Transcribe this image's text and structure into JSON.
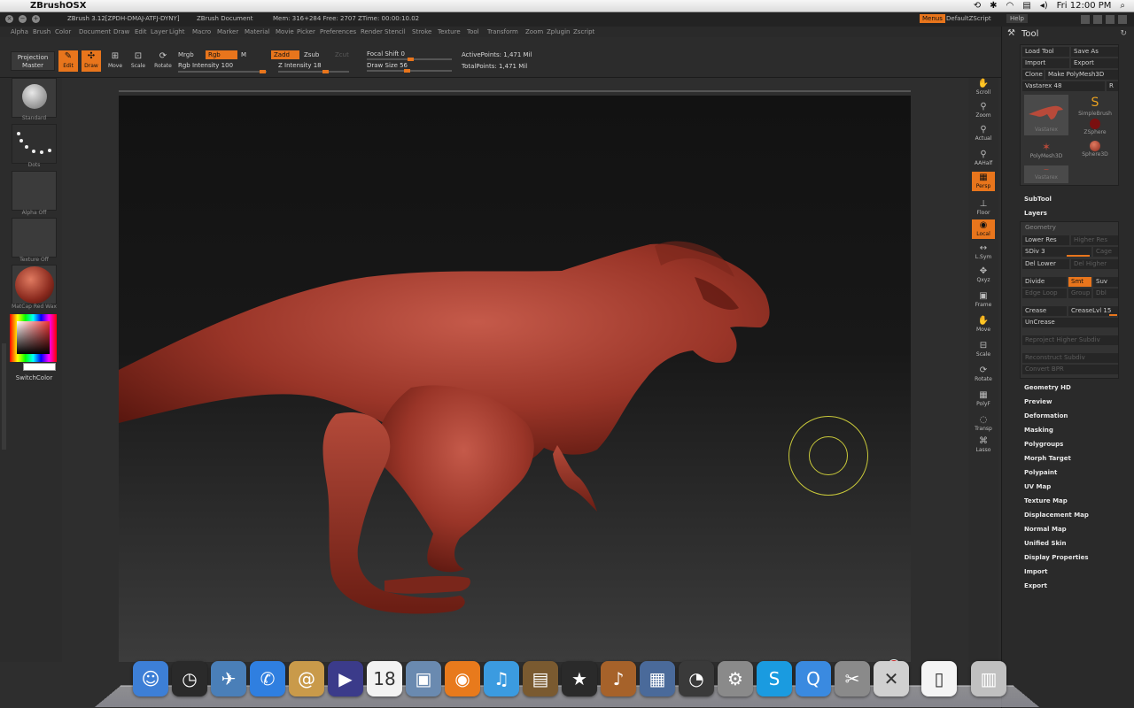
{
  "macbar": {
    "app_name": "ZBrushOSX",
    "clock": "Fri 12:00 PM"
  },
  "zbtitle": {
    "doc_path": "ZBrush 3.12[ZPDH-DMAJ-ATFJ-DYNY]",
    "doc_name": "ZBrush Document",
    "mem": "Mem: 316+284  Free: 2707  ZTime: 00:00:10.02",
    "menus": "Menus",
    "default_zscript": "DefaultZScript",
    "help": "Help"
  },
  "menu": [
    "Alpha",
    "Brush",
    "Color",
    "Document",
    "Draw",
    "Edit",
    "Layer",
    "Light",
    "Macro",
    "Marker",
    "Material",
    "Movie",
    "Picker",
    "Preferences",
    "Render",
    "Stencil",
    "Stroke",
    "Texture",
    "Tool",
    "Transform",
    "Zoom",
    "Zplugin",
    "Zscript"
  ],
  "shelf": {
    "projection_master": [
      "Projection",
      "Master"
    ],
    "edit": "Edit",
    "draw": "Draw",
    "move": "Move",
    "scale": "Scale",
    "rotate": "Rotate",
    "mrgb": "Mrgb",
    "rgb": "Rgb",
    "m": "M",
    "rgb_intensity": "Rgb Intensity 100",
    "zadd": "Zadd",
    "zsub": "Zsub",
    "zcut": "Zcut",
    "z_intensity": "Z Intensity 18",
    "focal_shift": "Focal Shift 0",
    "draw_size": "Draw Size 56",
    "active_points": "ActivePoints: 1,471  Mil",
    "total_points": "TotalPoints: 1,471  Mil"
  },
  "left_tray": {
    "items": [
      "Standard",
      "Dots",
      "Alpha Off",
      "Texture Off",
      "MatCap Red Wax"
    ],
    "switch_color": "SwitchColor"
  },
  "right_shelf": [
    "Scroll",
    "Zoom",
    "Actual",
    "AAHalf",
    "Persp",
    "Floor",
    "Local",
    "L.Sym",
    "Qxyz",
    "Frame",
    "Move",
    "Scale",
    "Rotate",
    "PolyF",
    "Transp",
    "Lasso"
  ],
  "tool": {
    "title": "Tool",
    "load_tool": "Load Tool",
    "save_as": "Save As",
    "import": "Import",
    "export": "Export",
    "clone": "Clone",
    "make_polymesh": "Make PolyMesh3D",
    "current": "Vastarex 48",
    "r": "R",
    "subtools": [
      "Vastarex",
      "SimpleBrush",
      "PolyMesh3D",
      "ZSphere",
      "Sphere3D",
      "Vastarex"
    ],
    "subtool": "SubTool",
    "layers": "Layers",
    "geometry": "Geometry",
    "lower_res": "Lower Res",
    "higher_res": "Higher Res",
    "sdiv": "SDiv 3",
    "cage": "Cage",
    "del_lower": "Del Lower",
    "del_higher": "Del Higher",
    "divide": "Divide",
    "smt": "Smt",
    "suv": "Suv",
    "edge_loop": "Edge Loop",
    "group": "Group",
    "dbl": "Dbl",
    "crease": "Crease",
    "creaselvl": "CreaseLvl 15",
    "uncrease": "UnCrease",
    "reproject": "Reproject Higher Subdiv",
    "reconstruct": "Reconstruct Subdiv",
    "convert": "Convert BPR",
    "sections": [
      "Geometry HD",
      "Preview",
      "Deformation",
      "Masking",
      "Polygroups",
      "Morph Target",
      "Polypaint",
      "UV Map",
      "Texture Map",
      "Displacement Map",
      "Normal Map",
      "Unified Skin",
      "Display Properties",
      "Import",
      "Export"
    ]
  },
  "dock": [
    "Finder",
    "Dashboard",
    "Mail",
    "iChat",
    "Address Book",
    "Front Row",
    "iCal",
    "iPhoto",
    "Firefox",
    "iTunes",
    "Preview",
    "iMovie",
    "GarageBand",
    "Exposé",
    "Time Machine",
    "System Preferences",
    "Skype",
    "QuickTime",
    "Utilities",
    "ZBrush",
    "Document",
    "Trash"
  ],
  "badges": {
    "skype": "1"
  }
}
